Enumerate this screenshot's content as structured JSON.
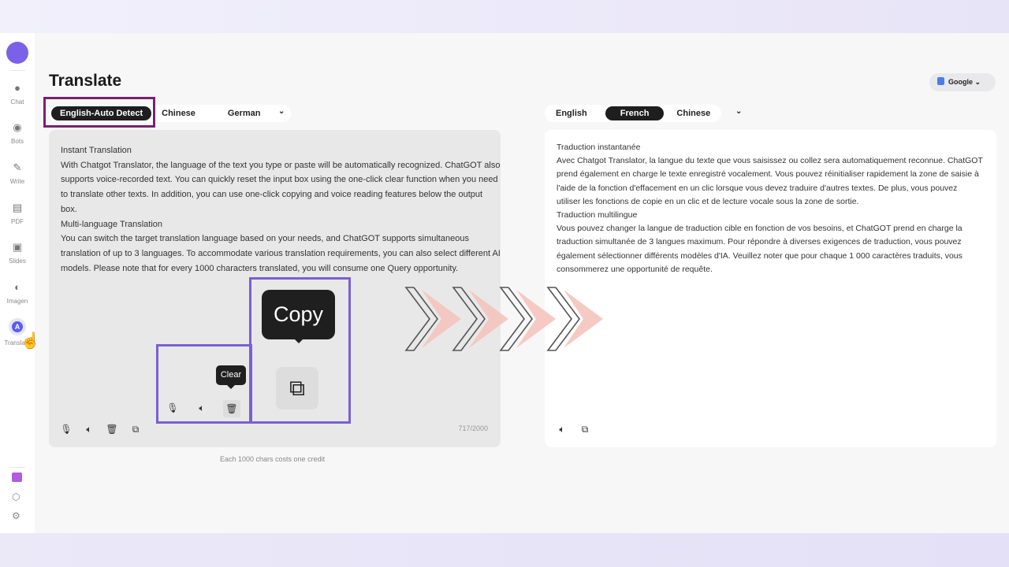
{
  "sidebar": {
    "items": [
      {
        "label": "Chat",
        "icon": "chat-icon"
      },
      {
        "label": "Bots",
        "icon": "bot-icon"
      },
      {
        "label": "Write",
        "icon": "pen-icon"
      },
      {
        "label": "PDF",
        "icon": "pdf-icon"
      },
      {
        "label": "Slides",
        "icon": "slides-icon"
      },
      {
        "label": "Imagen",
        "icon": "image-icon"
      },
      {
        "label": "Translate",
        "icon": "translate-icon"
      }
    ],
    "bottom_icons": [
      "gift-icon",
      "cube-icon",
      "settings-icon"
    ]
  },
  "header": {
    "title": "Translate",
    "engine": "Google"
  },
  "source": {
    "tabs": [
      "English-Auto Detect",
      "Chinese",
      "German"
    ],
    "selected": 0,
    "lines": [
      "Instant Translation",
      "With Chatgot Translator, the language of the text you type or paste will be automatically recognized. ChatGOT also",
      "supports voice-recorded text. You can quickly reset the input box using the one-click clear function when you need",
      "to translate other texts. In addition, you can use one-click copying and voice reading features below the output",
      "box.",
      "Multi-language Translation",
      "You can switch the target translation language based on your needs, and ChatGOT supports simultaneous",
      "translation of up to 3 languages. To accommodate various translation requirements, you can also select different AI",
      "models. Please note that for every 1000 characters translated, you will consume one Query opportunity."
    ],
    "count": "717/2000",
    "credit_note": "Each 1000 chars costs one credit"
  },
  "target": {
    "tabs": [
      "English",
      "French",
      "Chinese"
    ],
    "selected": 1,
    "lines": [
      "Traduction instantanée",
      "Avec Chatgot Translator, la langue du texte que vous saisissez ou collez sera automatiquement reconnue. ChatGOT",
      "prend également en charge le texte enregistré vocalement. Vous pouvez réinitialiser rapidement la zone de saisie à",
      "l'aide de la fonction d'effacement en un clic lorsque vous devez traduire d'autres textes. De plus, vous pouvez",
      "utiliser les fonctions de copie en un clic et de lecture vocale sous la zone de sortie.",
      "Traduction multilingue",
      "Vous pouvez changer la langue de traduction cible en fonction de vos besoins, et ChatGOT prend en charge la",
      "traduction simultanée de 3 langues maximum. Pour répondre à diverses exigences de traduction, vous pouvez",
      "également sélectionner différents modèles d'IA. Veuillez noter que pour chaque 1 000 caractères traduits, vous",
      "consommerez une opportunité de requête."
    ]
  },
  "tooltips": {
    "clear": "Clear",
    "copy": "Copy"
  },
  "colors": {
    "accent": "#7b61e8",
    "highlight": "#7a5fd6",
    "arrow": "#f4c4bc"
  }
}
